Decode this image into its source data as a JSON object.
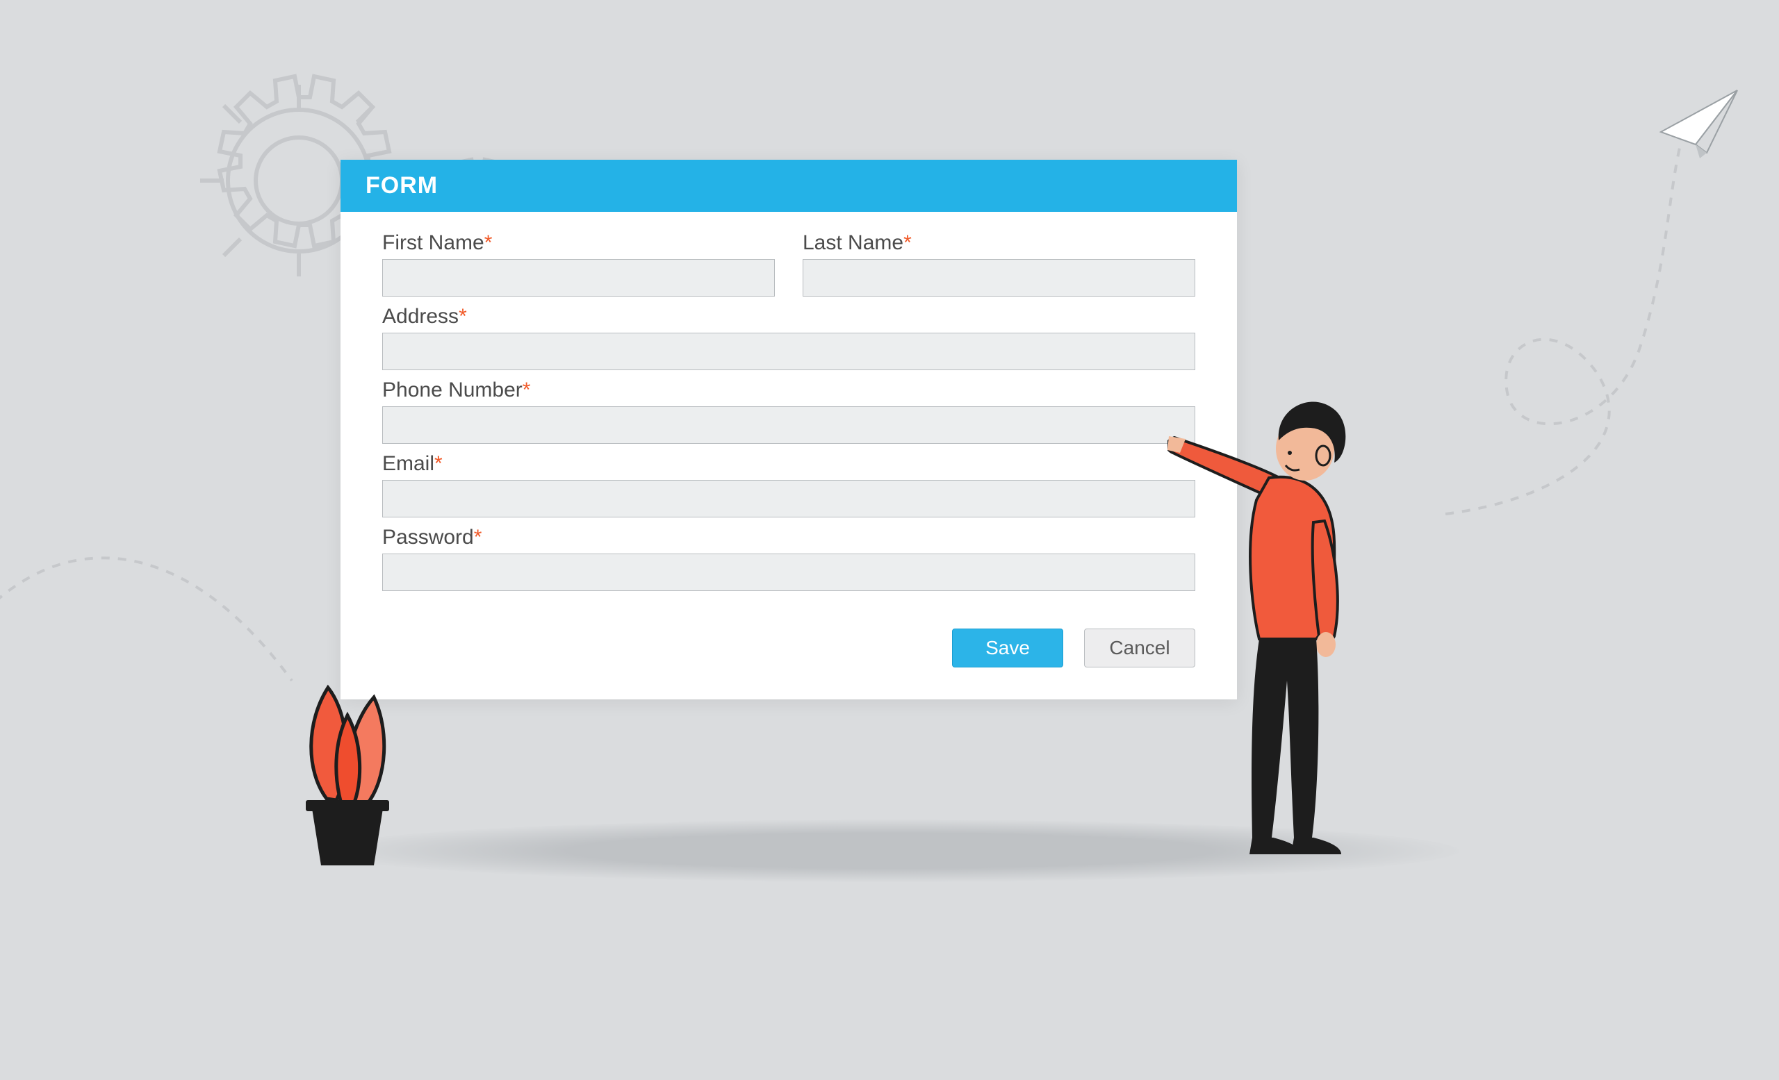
{
  "form": {
    "title": "FORM",
    "fields": {
      "first_name": {
        "label": "First Name",
        "required": true,
        "value": ""
      },
      "last_name": {
        "label": "Last Name",
        "required": true,
        "value": ""
      },
      "address": {
        "label": "Address",
        "required": true,
        "value": ""
      },
      "phone": {
        "label": "Phone Number",
        "required": true,
        "value": ""
      },
      "email": {
        "label": "Email",
        "required": true,
        "value": ""
      },
      "password": {
        "label": "Password",
        "required": true,
        "value": ""
      }
    },
    "actions": {
      "save": "Save",
      "cancel": "Cancel"
    }
  },
  "colors": {
    "accent": "#24b2e7",
    "required": "#f15a29",
    "input_bg": "#eceeef",
    "input_border": "#b8bcbf",
    "page_bg": "#dadcde"
  }
}
